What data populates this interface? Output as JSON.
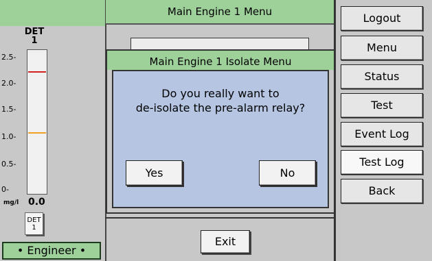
{
  "left_panel": {
    "detector_title_line1": "DET",
    "detector_title_line2": "1",
    "ticks": [
      "2.5-",
      "2.0-",
      "1.5-",
      "1.0-",
      "0.5-",
      "0-"
    ],
    "unit": "mg/l",
    "reading": "0.0",
    "det_button_line1": "DET",
    "det_button_line2": "1",
    "role_badge": "• Engineer •",
    "colors": {
      "alarm_line": "#d02020",
      "prealarm_line": "#f0a020",
      "bar_fill": "#f0f0f0"
    }
  },
  "main_menu": {
    "title": "Main Engine 1 Menu",
    "exit_label": "Exit"
  },
  "dialog": {
    "title": "Main Engine 1 Isolate Menu",
    "message_line1": "Do you really want to",
    "message_line2": "de-isolate the pre-alarm relay?",
    "yes_label": "Yes",
    "no_label": "No"
  },
  "side_menu": {
    "items": [
      {
        "label": "Logout"
      },
      {
        "label": "Menu"
      },
      {
        "label": "Status"
      },
      {
        "label": "Test"
      },
      {
        "label": "Event Log"
      },
      {
        "label": "Test Log"
      },
      {
        "label": "Back"
      }
    ]
  },
  "theme": {
    "header_green": "#9ed09a",
    "dialog_blue": "#b5c5e2",
    "background_grey": "#c8c8c8"
  }
}
